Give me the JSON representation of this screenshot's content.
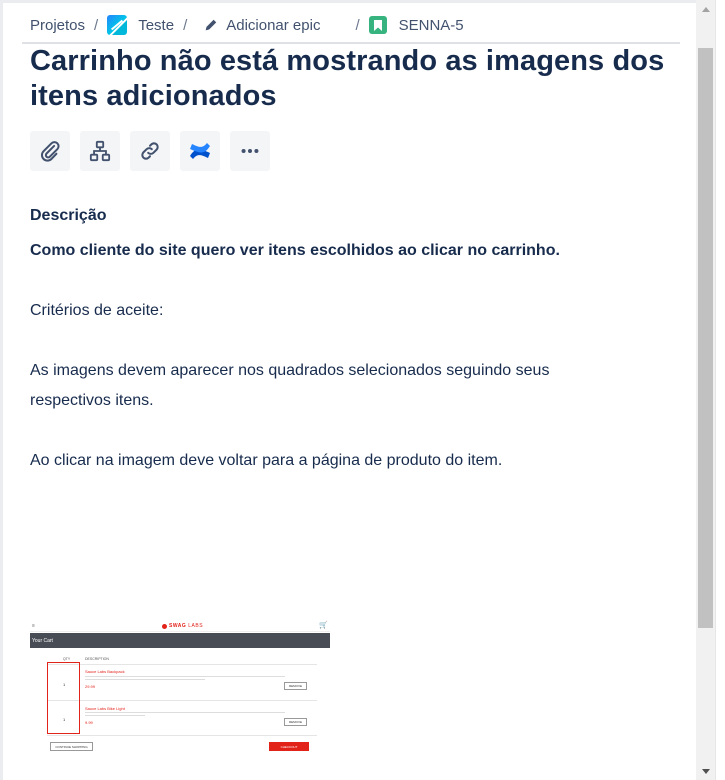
{
  "breadcrumb": {
    "projects": "Projetos",
    "project": "Teste",
    "add_epic": "Adicionar epic",
    "issue_key": "SENNA-5",
    "separator": "/"
  },
  "issue": {
    "title": "Carrinho não está mostrando as imagens dos itens adicionados"
  },
  "toolbar": {
    "icons": [
      "paperclip-icon",
      "hierarchy-icon",
      "link-icon",
      "confluence-icon",
      "more-icon"
    ]
  },
  "description": {
    "label": "Descrição",
    "lines": {
      "story": "Como cliente do site quero ver itens escolhidos ao clicar no carrinho.",
      "criteria": "Critérios de aceite:",
      "criterion1": "As imagens devem aparecer nos quadrados selecionados seguindo seus respectivos itens.",
      "criterion2": "Ao clicar na imagem deve voltar para a página de produto do item."
    }
  },
  "attachment": {
    "logo": "SWAG",
    "logo_suffix": "LABS",
    "bar_title": "Your Cart",
    "col_qty": "QTY",
    "col_desc": "DESCRIPTION",
    "items": [
      {
        "qty": "1",
        "name": "Sauce Labs Backpack",
        "price": "29.99",
        "remove": "REMOVE"
      },
      {
        "qty": "1",
        "name": "Sauce Labs Bike Light",
        "price": "9.99",
        "remove": "REMOVE"
      }
    ],
    "continue": "CONTINUE SHOPPING",
    "checkout": "CHECKOUT"
  },
  "colors": {
    "text": "#172b4d",
    "button_bg": "#f4f5f7",
    "story_green": "#36b37e",
    "confluence_blue": "#0052cc",
    "swag_red": "#e2231a"
  }
}
